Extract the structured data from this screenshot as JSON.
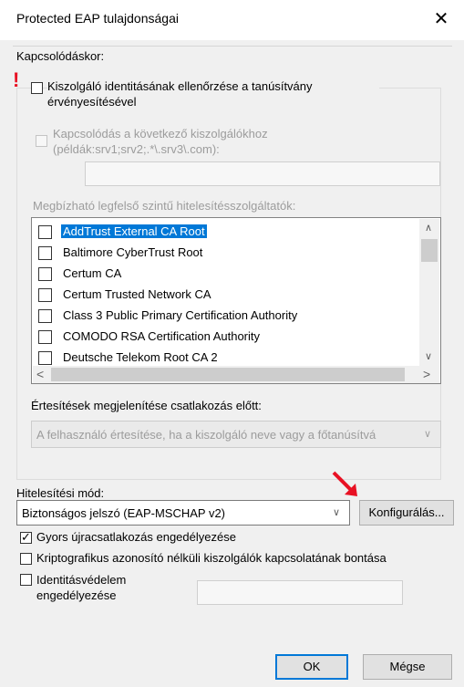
{
  "window": {
    "title": "Protected EAP tulajdonságai",
    "close_symbol": "✕"
  },
  "connect_group": {
    "label": "Kapcsolódáskor:",
    "verify_identity_label": "Kiszolgáló identitásának ellenőrzése a tanúsítvány érvényesítésével",
    "verify_identity_checked": false,
    "connect_servers_label": "Kapcsolódás a következő kiszolgálókhoz (példák:srv1;srv2;.*\\.srv3\\.com):",
    "connect_servers_value": "",
    "trusted_roots_label": "Megbízható legfelső szintű hitelesítésszolgáltatók:",
    "trusted_roots": [
      {
        "label": "AddTrust External CA Root",
        "checked": false,
        "selected": true
      },
      {
        "label": "Baltimore CyberTrust Root",
        "checked": false,
        "selected": false
      },
      {
        "label": "Certum CA",
        "checked": false,
        "selected": false
      },
      {
        "label": "Certum Trusted Network CA",
        "checked": false,
        "selected": false
      },
      {
        "label": "Class 3 Public Primary Certification Authority",
        "checked": false,
        "selected": false
      },
      {
        "label": "COMODO RSA Certification Authority",
        "checked": false,
        "selected": false
      },
      {
        "label": "Deutsche Telekom Root CA 2",
        "checked": false,
        "selected": false
      }
    ],
    "notifications_label": "Értesítések megjelenítése csatlakozás előtt:",
    "notifications_value": "A felhasználó értesítése, ha a kiszolgáló neve vagy a főtanúsítvá"
  },
  "auth": {
    "label": "Hitelesítési mód:",
    "method_value": "Biztonságos jelszó (EAP-MSCHAP v2)",
    "configure_label": "Konfigurálás..."
  },
  "options": {
    "fast_reconnect_label": "Gyors újracsatlakozás engedélyezése",
    "fast_reconnect_checked": true,
    "disconnect_label": "Kriptografikus azonosító nélküli kiszolgálók kapcsolatának bontása",
    "disconnect_checked": false,
    "identity_privacy_label": "Identitásvédelem engedélyezése",
    "identity_privacy_checked": false,
    "identity_privacy_value": ""
  },
  "buttons": {
    "ok_label": "OK",
    "cancel_label": "Mégse"
  },
  "colors": {
    "selection": "#0078d7",
    "annotation_red": "#e81123"
  }
}
